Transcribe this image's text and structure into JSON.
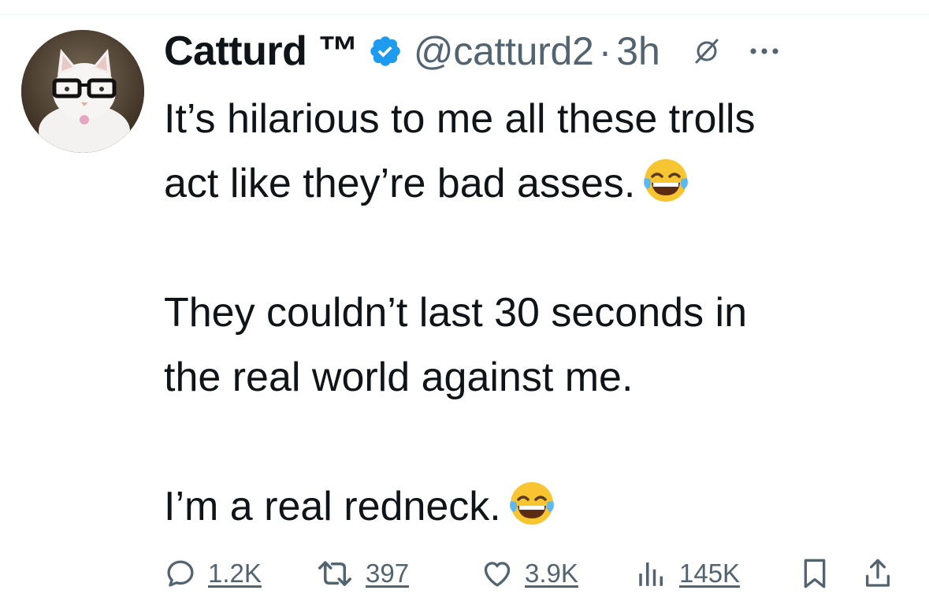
{
  "tweet": {
    "author": {
      "display_name": "Catturd ™",
      "handle": "@catturd2",
      "verified": true,
      "avatar": "cat-with-glasses-avatar"
    },
    "separator": "·",
    "timestamp": "3h",
    "paragraphs": [
      "It’s hilarious to me all these trolls\nact like they’re bad asses.",
      "They couldn’t last 30 seconds in\nthe real world against me.",
      "I’m a real redneck."
    ],
    "emoji": "face-with-tears-of-joy"
  },
  "actions": {
    "replies": "1.2K",
    "reposts": "397",
    "likes": "3.9K",
    "views": "145K"
  },
  "colors": {
    "text": "#0f1419",
    "secondary": "#536471",
    "verified": "#1d9bf0",
    "divider": "#eff3f4"
  }
}
